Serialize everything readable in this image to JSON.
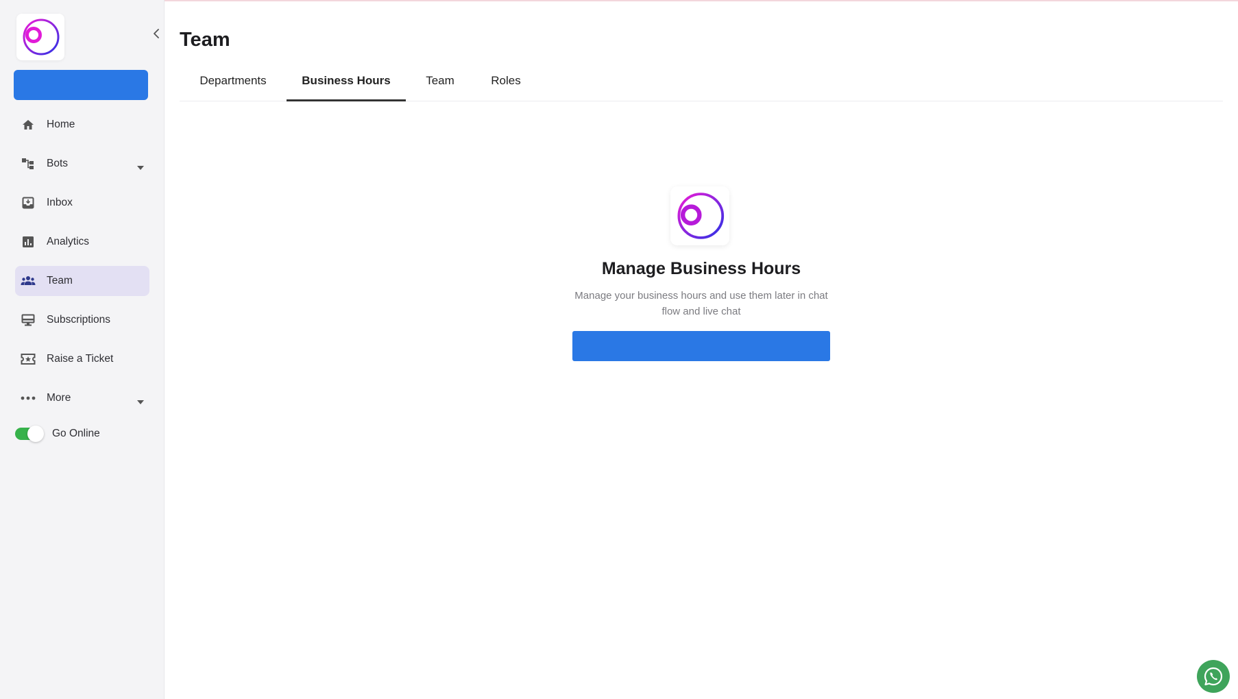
{
  "app": {
    "brand_colors": {
      "primary": "#2a78e5",
      "logo_gradient_start": "#e91ad9",
      "logo_gradient_end": "#2b35e8",
      "active_nav_bg": "#e3e0f3",
      "toggle_on": "#36b24a"
    }
  },
  "sidebar": {
    "logo_icon": "brand-logo-icon",
    "collapse_icon": "chevron-left-icon",
    "primary_button_label": "",
    "items": [
      {
        "label": "Home",
        "icon": "home-icon",
        "has_caret": false,
        "active": false
      },
      {
        "label": "Bots",
        "icon": "flow-icon",
        "has_caret": true,
        "active": false
      },
      {
        "label": "Inbox",
        "icon": "inbox-icon",
        "has_caret": false,
        "active": false
      },
      {
        "label": "Analytics",
        "icon": "bar-chart-icon",
        "has_caret": false,
        "active": false
      },
      {
        "label": "Team",
        "icon": "people-icon",
        "has_caret": false,
        "active": true
      },
      {
        "label": "Subscriptions",
        "icon": "monitor-icon",
        "has_caret": false,
        "active": false
      },
      {
        "label": "Raise a Ticket",
        "icon": "ticket-icon",
        "has_caret": false,
        "active": false
      },
      {
        "label": "More",
        "icon": "more-dots-icon",
        "has_caret": true,
        "active": false
      }
    ],
    "go_online": {
      "label": "Go Online",
      "on": true
    }
  },
  "main": {
    "title": "Team",
    "tabs": [
      {
        "label": "Departments",
        "active": false
      },
      {
        "label": "Business Hours",
        "active": true
      },
      {
        "label": "Team",
        "active": false
      },
      {
        "label": "Roles",
        "active": false
      }
    ],
    "empty_state": {
      "title": "Manage Business Hours",
      "description": "Manage your business hours and use them later in chat flow and live chat",
      "button_label": ""
    }
  },
  "fab": {
    "icon": "whatsapp-icon"
  }
}
